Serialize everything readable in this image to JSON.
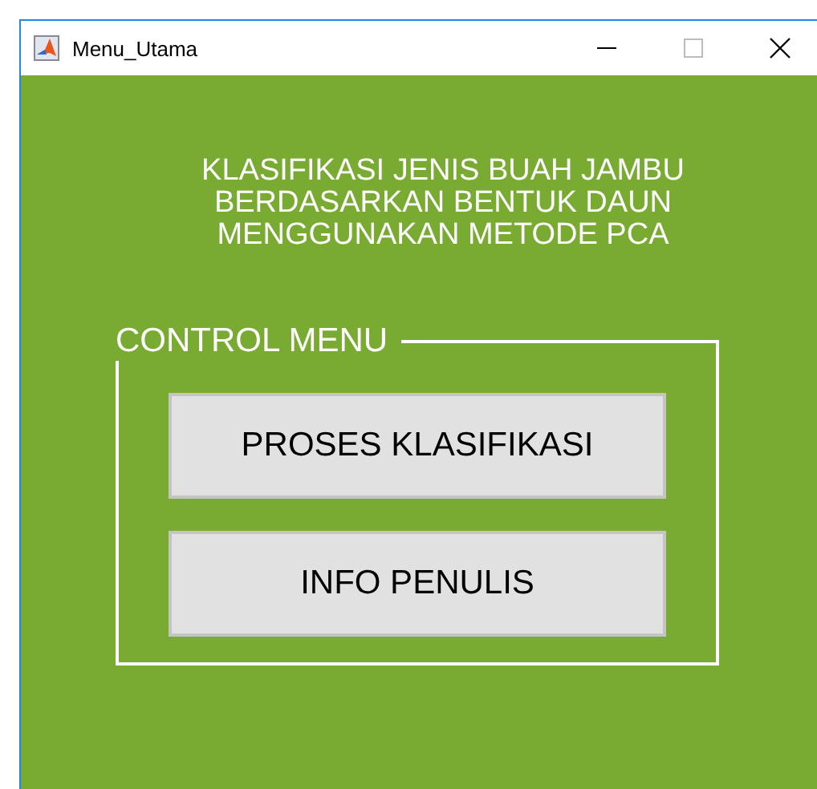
{
  "window": {
    "title": "Menu_Utama"
  },
  "heading": "KLASIFIKASI JENIS BUAH JAMBU\nBERDASARKAN BENTUK DAUN\nMENGGUNAKAN METODE PCA",
  "panel": {
    "title": "CONTROL MENU",
    "buttons": [
      "PROSES KLASIFIKASI",
      "INFO PENULIS"
    ]
  }
}
